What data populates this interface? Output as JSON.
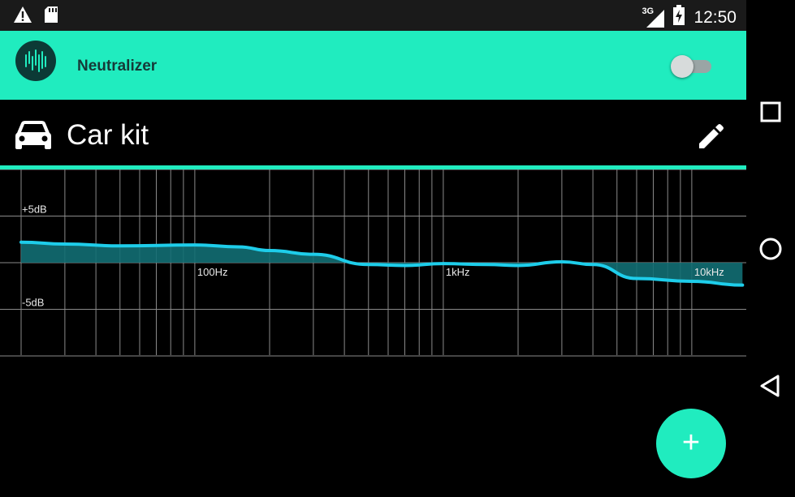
{
  "status_bar": {
    "time": "12:50",
    "network_type": "3G",
    "icons": [
      "warning-icon",
      "sd-card-icon",
      "signal-icon",
      "battery-charging-icon"
    ]
  },
  "app_bar": {
    "title": "Neutralizer",
    "toggle_state": "off",
    "accent_color": "#20ecbf"
  },
  "profile": {
    "name": "Car kit",
    "icon": "car-icon"
  },
  "chart_data": {
    "type": "area",
    "x_scale": "log",
    "x_tick_labels": [
      "100Hz",
      "1kHz",
      "10kHz"
    ],
    "y_tick_labels": [
      "+5dB",
      "-5dB"
    ],
    "xlim_hz": [
      20,
      20000
    ],
    "ylim_db": [
      -10,
      10
    ],
    "grid": true,
    "series": [
      {
        "x": [
          20,
          30,
          50,
          100,
          150,
          200,
          300,
          500,
          700,
          1000,
          1500,
          2000,
          3000,
          4000,
          6000,
          10000,
          16000
        ],
        "y": [
          2.2,
          2.0,
          1.8,
          1.9,
          1.7,
          1.3,
          0.9,
          -0.2,
          -0.3,
          -0.1,
          -0.2,
          -0.3,
          0.1,
          -0.2,
          -1.7,
          -2.0,
          -2.4
        ]
      }
    ],
    "line_color": "#1ecdea",
    "fill_color": "#126e73"
  },
  "fab": {
    "label": "+"
  },
  "nav_bar": {
    "buttons": [
      "recents-button",
      "home-button",
      "back-button"
    ]
  }
}
